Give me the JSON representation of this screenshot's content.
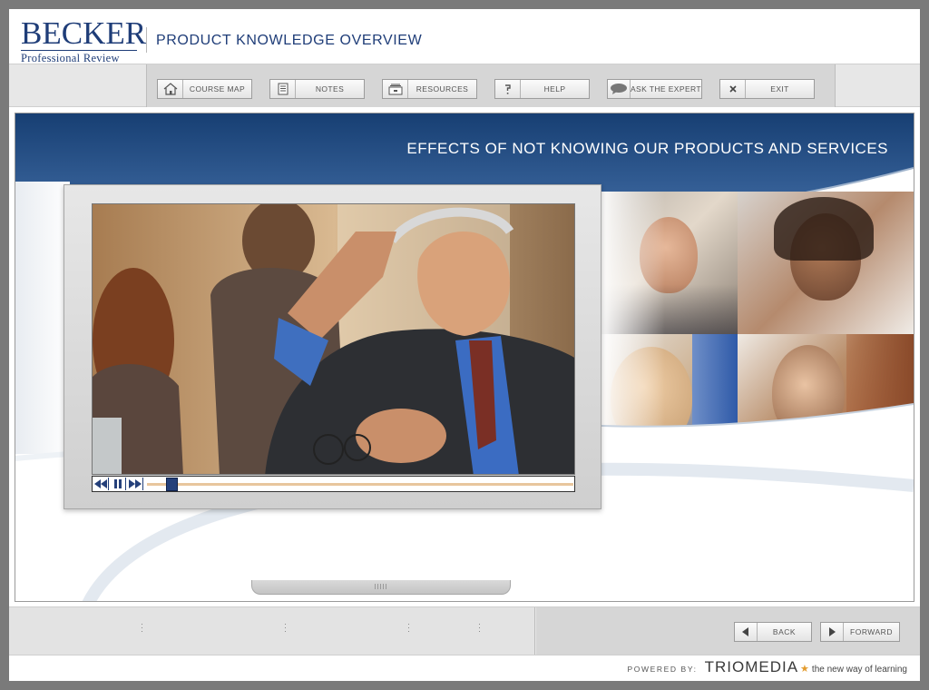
{
  "header": {
    "logo_main": "BECKER",
    "logo_sub": "Professional Review",
    "title": "PRODUCT KNOWLEDGE OVERVIEW"
  },
  "toolbar": {
    "buttons": [
      {
        "id": "course-map",
        "label": "COURSE MAP",
        "icon": "house-icon"
      },
      {
        "id": "notes",
        "label": "NOTES",
        "icon": "document-icon"
      },
      {
        "id": "resources",
        "label": "RESOURCES",
        "icon": "file-drawer-icon"
      },
      {
        "id": "help",
        "label": "HELP",
        "icon": "question-mark-icon"
      },
      {
        "id": "ask-the-expert",
        "label": "ASK THE EXPERT",
        "icon": "speech-bubble-icon"
      },
      {
        "id": "exit",
        "label": "EXIT",
        "icon": "close-icon"
      }
    ]
  },
  "stage": {
    "banner_title": "EFFECTS OF NOT KNOWING OUR PRODUCTS AND SERVICES",
    "video": {
      "progress": 0.06,
      "controls": [
        "rewind-icon",
        "pause-icon",
        "fast-forward-icon"
      ]
    }
  },
  "footer": {
    "back_label": "BACK",
    "forward_label": "FORWARD"
  },
  "powered_by": {
    "label": "POWERED BY:",
    "brand": "TRIOMEDIA",
    "tagline": "the new way of learning"
  },
  "colors": {
    "brand_navy": "#1f3d78",
    "banner_blue": "#1f4e86",
    "accent_orange": "#e39b2d",
    "toolbar_gray": "#d6d6d6"
  }
}
